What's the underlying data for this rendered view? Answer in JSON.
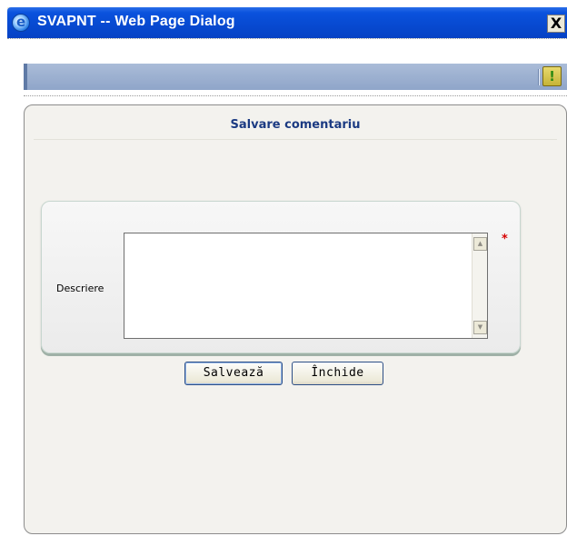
{
  "window": {
    "title": "SVAPNT -- Web Page Dialog",
    "close_glyph": "X",
    "icon": "ie-icon"
  },
  "toolbar": {
    "alert_glyph": "!",
    "alert_icon": "exclamation-icon"
  },
  "form": {
    "title": "Salvare comentariu",
    "description_label": "Descriere",
    "description_value": "",
    "required_marker": "*"
  },
  "buttons": {
    "save_label": "Salvează",
    "close_label": "Închide"
  },
  "colors": {
    "titlebar": "#0a52dd",
    "form_title": "#1b3a82",
    "required": "#d60000",
    "toolbar": "#8fa5c9"
  }
}
